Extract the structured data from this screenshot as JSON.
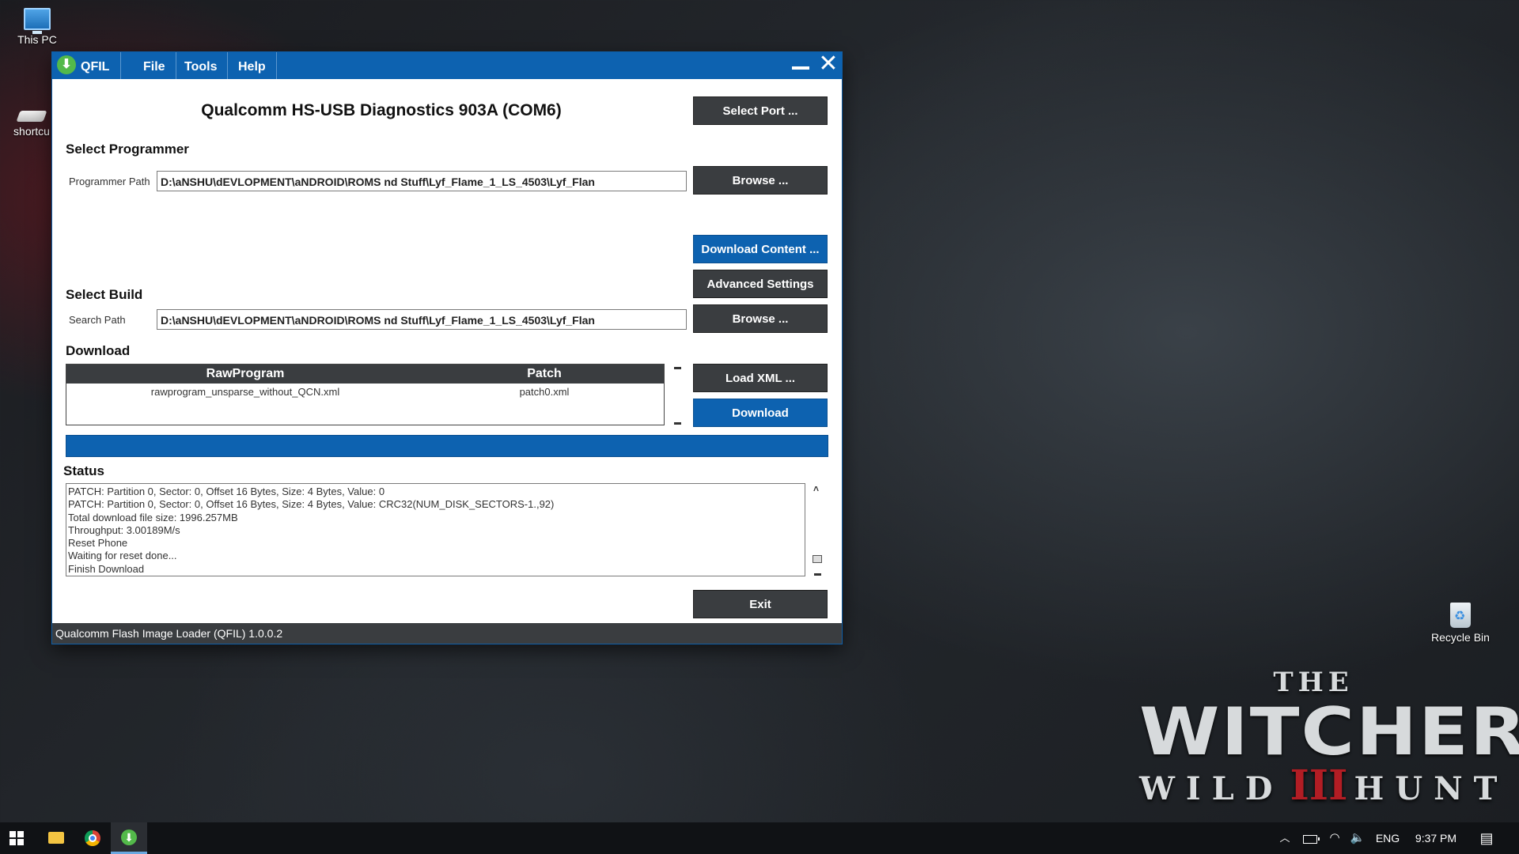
{
  "desktop": {
    "icons": [
      {
        "label": "This PC"
      },
      {
        "label": "shortcu"
      },
      {
        "label": "Recycle Bin"
      }
    ],
    "wallpaper_logo": {
      "the": "THE",
      "title": "WITCHER",
      "sub_left": "WILD",
      "sub_mark": "III",
      "sub_right": "HUNT"
    }
  },
  "window": {
    "app_name": "QFIL",
    "menu": [
      "File",
      "Tools",
      "Help"
    ],
    "port_title": "Qualcomm HS-USB Diagnostics 903A (COM6)",
    "select_port_label": "Select Port ...",
    "select_programmer": {
      "heading": "Select Programmer",
      "field_label": "Programmer Path",
      "path_value": "D:\\aNSHU\\dEVLOPMENT\\aNDROID\\ROMS nd Stuff\\Lyf_Flame_1_LS_4503\\Lyf_Flan",
      "browse_label": "Browse ..."
    },
    "download_content_label": "Download Content ...",
    "advanced_settings_label": "Advanced Settings",
    "select_build": {
      "heading": "Select Build",
      "field_label": "Search Path",
      "path_value": "D:\\aNSHU\\dEVLOPMENT\\aNDROID\\ROMS nd Stuff\\Lyf_Flame_1_LS_4503\\Lyf_Flan",
      "browse_label": "Browse ..."
    },
    "download": {
      "heading": "Download",
      "columns": [
        "RawProgram",
        "Patch"
      ],
      "rows": [
        {
          "rawprogram": "rawprogram_unsparse_without_QCN.xml",
          "patch": "patch0.xml"
        }
      ],
      "load_xml_label": "Load XML ...",
      "download_label": "Download",
      "progress_percent": 100
    },
    "status": {
      "heading": "Status",
      "lines": [
        "PATCH: Partition 0, Sector: 0, Offset 16 Bytes, Size: 4 Bytes, Value: 0",
        "PATCH: Partition 0, Sector: 0, Offset 16 Bytes, Size: 4 Bytes, Value: CRC32(NUM_DISK_SECTORS-1.,92)",
        "Total download file size: 1996.257MB",
        "Throughput: 3.00189M/s",
        "Reset Phone",
        "Waiting for reset done...",
        "Finish Download"
      ]
    },
    "exit_label": "Exit",
    "statusbar_text": "Qualcomm Flash Image Loader (QFIL)  1.0.0.2"
  },
  "taskbar": {
    "language": "ENG",
    "clock": "9:37 PM"
  },
  "colors": {
    "accent_blue": "#0d62b0",
    "button_dark": "#3a3d40",
    "qfil_icon_green": "#53b94a"
  }
}
